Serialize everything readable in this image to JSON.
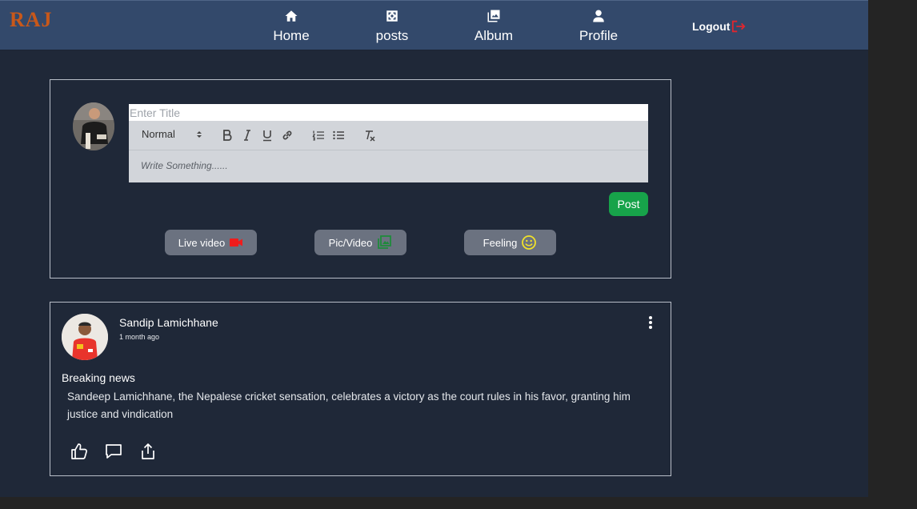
{
  "app": {
    "logo": "RAJ"
  },
  "nav": {
    "items": [
      {
        "label": "Home",
        "icon": "home-icon"
      },
      {
        "label": "posts",
        "icon": "posts-icon"
      },
      {
        "label": "Album",
        "icon": "album-icon"
      },
      {
        "label": "Profile",
        "icon": "profile-icon"
      }
    ],
    "logout_label": "Logout",
    "logout_icon": "logout-icon"
  },
  "composer": {
    "title_placeholder": "Enter Title",
    "format_select": "Normal",
    "body_placeholder": "Write Something......",
    "post_label": "Post",
    "actions": [
      {
        "label": "Live video",
        "icon": "video-camera-icon",
        "color": "#ef1c1c"
      },
      {
        "label": "Pic/Video",
        "icon": "gallery-icon",
        "color": "#1f8a3b"
      },
      {
        "label": "Feeling",
        "icon": "smiley-icon",
        "color": "#f0e12a"
      }
    ]
  },
  "post": {
    "author": "Sandip Lamichhane",
    "time": "1 month ago",
    "title": "Breaking news",
    "body": "Sandeep Lamichhane, the Nepalese cricket sensation, celebrates a victory as the court rules in his favor, granting him justice and vindication"
  },
  "colors": {
    "page_bg": "#1f2838",
    "navbar_bg": "#33496b",
    "logo": "#c8581a",
    "post_button": "#17a34a",
    "action_button": "#6b7280"
  }
}
